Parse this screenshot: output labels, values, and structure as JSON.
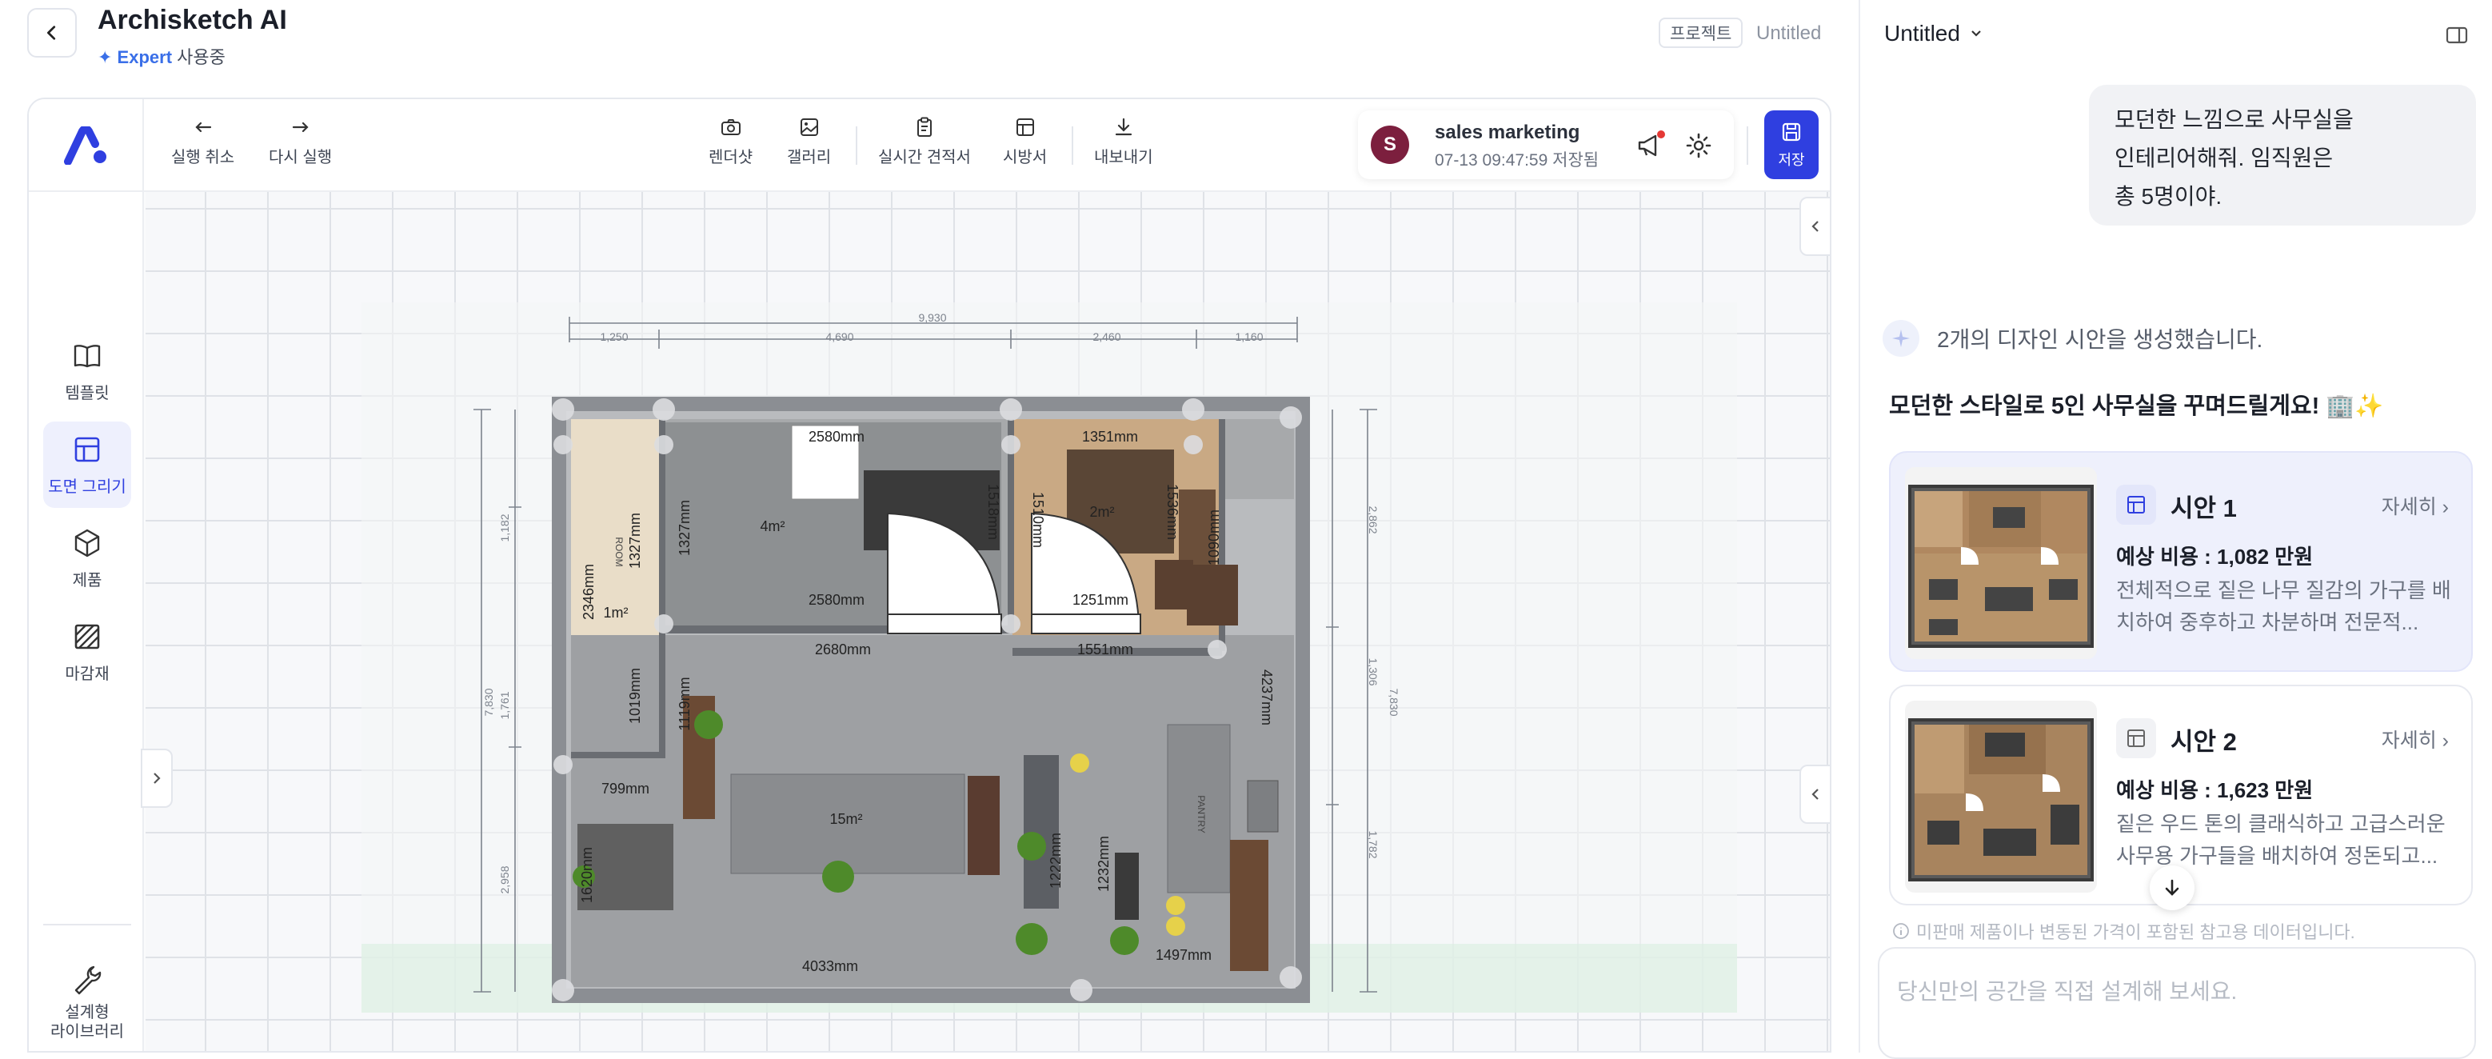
{
  "header": {
    "title": "Archisketch AI",
    "plan_badge": "✦ Expert",
    "plan_suffix": "사용중",
    "project_badge": "프로젝트",
    "project_name": "Untitled"
  },
  "toolbar": {
    "undo": "실행 취소",
    "redo": "다시 실행",
    "render": "렌더샷",
    "gallery": "갤러리",
    "estimate": "실시간 견적서",
    "spec": "시방서",
    "export": "내보내기",
    "user_initial": "S",
    "user_name": "sales marketing",
    "saved_status": "07-13 09:47:59 저장됨",
    "save": "저장"
  },
  "sidenav": {
    "items": [
      {
        "label": "템플릿",
        "icon": "book-icon"
      },
      {
        "label": "도면 그리기",
        "icon": "floorplan-icon"
      },
      {
        "label": "제품",
        "icon": "cube-icon"
      },
      {
        "label": "마감재",
        "icon": "hatch-icon"
      },
      {
        "label": "설계형\n라이브러리",
        "icon": "wrench-icon"
      }
    ]
  },
  "floorplan": {
    "total_dim": "9,930",
    "top_dims": [
      "1,250",
      "4,690",
      "2,460",
      "1,160"
    ],
    "left_dims": [
      "1,182",
      "1,761",
      "2,958"
    ],
    "left_outer": "7,830",
    "right_dims": [
      "2,862",
      "1,306",
      "1,782"
    ],
    "right_outer": "7,830",
    "labels": [
      "2580mm",
      "1351mm",
      "2m²",
      "4m²",
      "1327mm",
      "1327mm",
      "1518mm",
      "1510mm",
      "1536mm",
      "1090mm",
      "2580mm",
      "1251mm",
      "2346mm",
      "1m²",
      "2680mm",
      "1551mm",
      "1019mm",
      "1119mm",
      "4237mm",
      "799mm",
      "15m²",
      "1620mm",
      "1222mm",
      "1232mm",
      "4033mm",
      "1497mm",
      "PANTRY",
      "ROOM"
    ]
  },
  "panel": {
    "title": "Untitled",
    "user_message": "모던한 느낌으로 사무실을\n인테리어해줘. 임직원은\n총 5명이야.",
    "ai_status": "2개의 디자인 시안을 생성했습니다.",
    "ai_reply": "모던한 스타일로 5인 사무실을 꾸며드릴게요! 🏢✨",
    "cards": [
      {
        "name": "시안 1",
        "more": "자세히",
        "cost": "예상 비용 : 1,082 만원",
        "desc": "전체적으로 짙은 나무 질감의 가구를 배치하여 중후하고 차분하며 전문적..."
      },
      {
        "name": "시안 2",
        "more": "자세히",
        "cost": "예상 비용 : 1,623 만원",
        "desc": "짙은 우드 톤의 클래식하고 고급스러운 사무용 가구들을 배치하여 정돈되고..."
      }
    ],
    "disclaimer": "미판매 제품이나 변동된 가격이 포함된 참고용 데이터입니다.",
    "input_placeholder": "당신만의 공간을 직접 설계해 보세요."
  }
}
